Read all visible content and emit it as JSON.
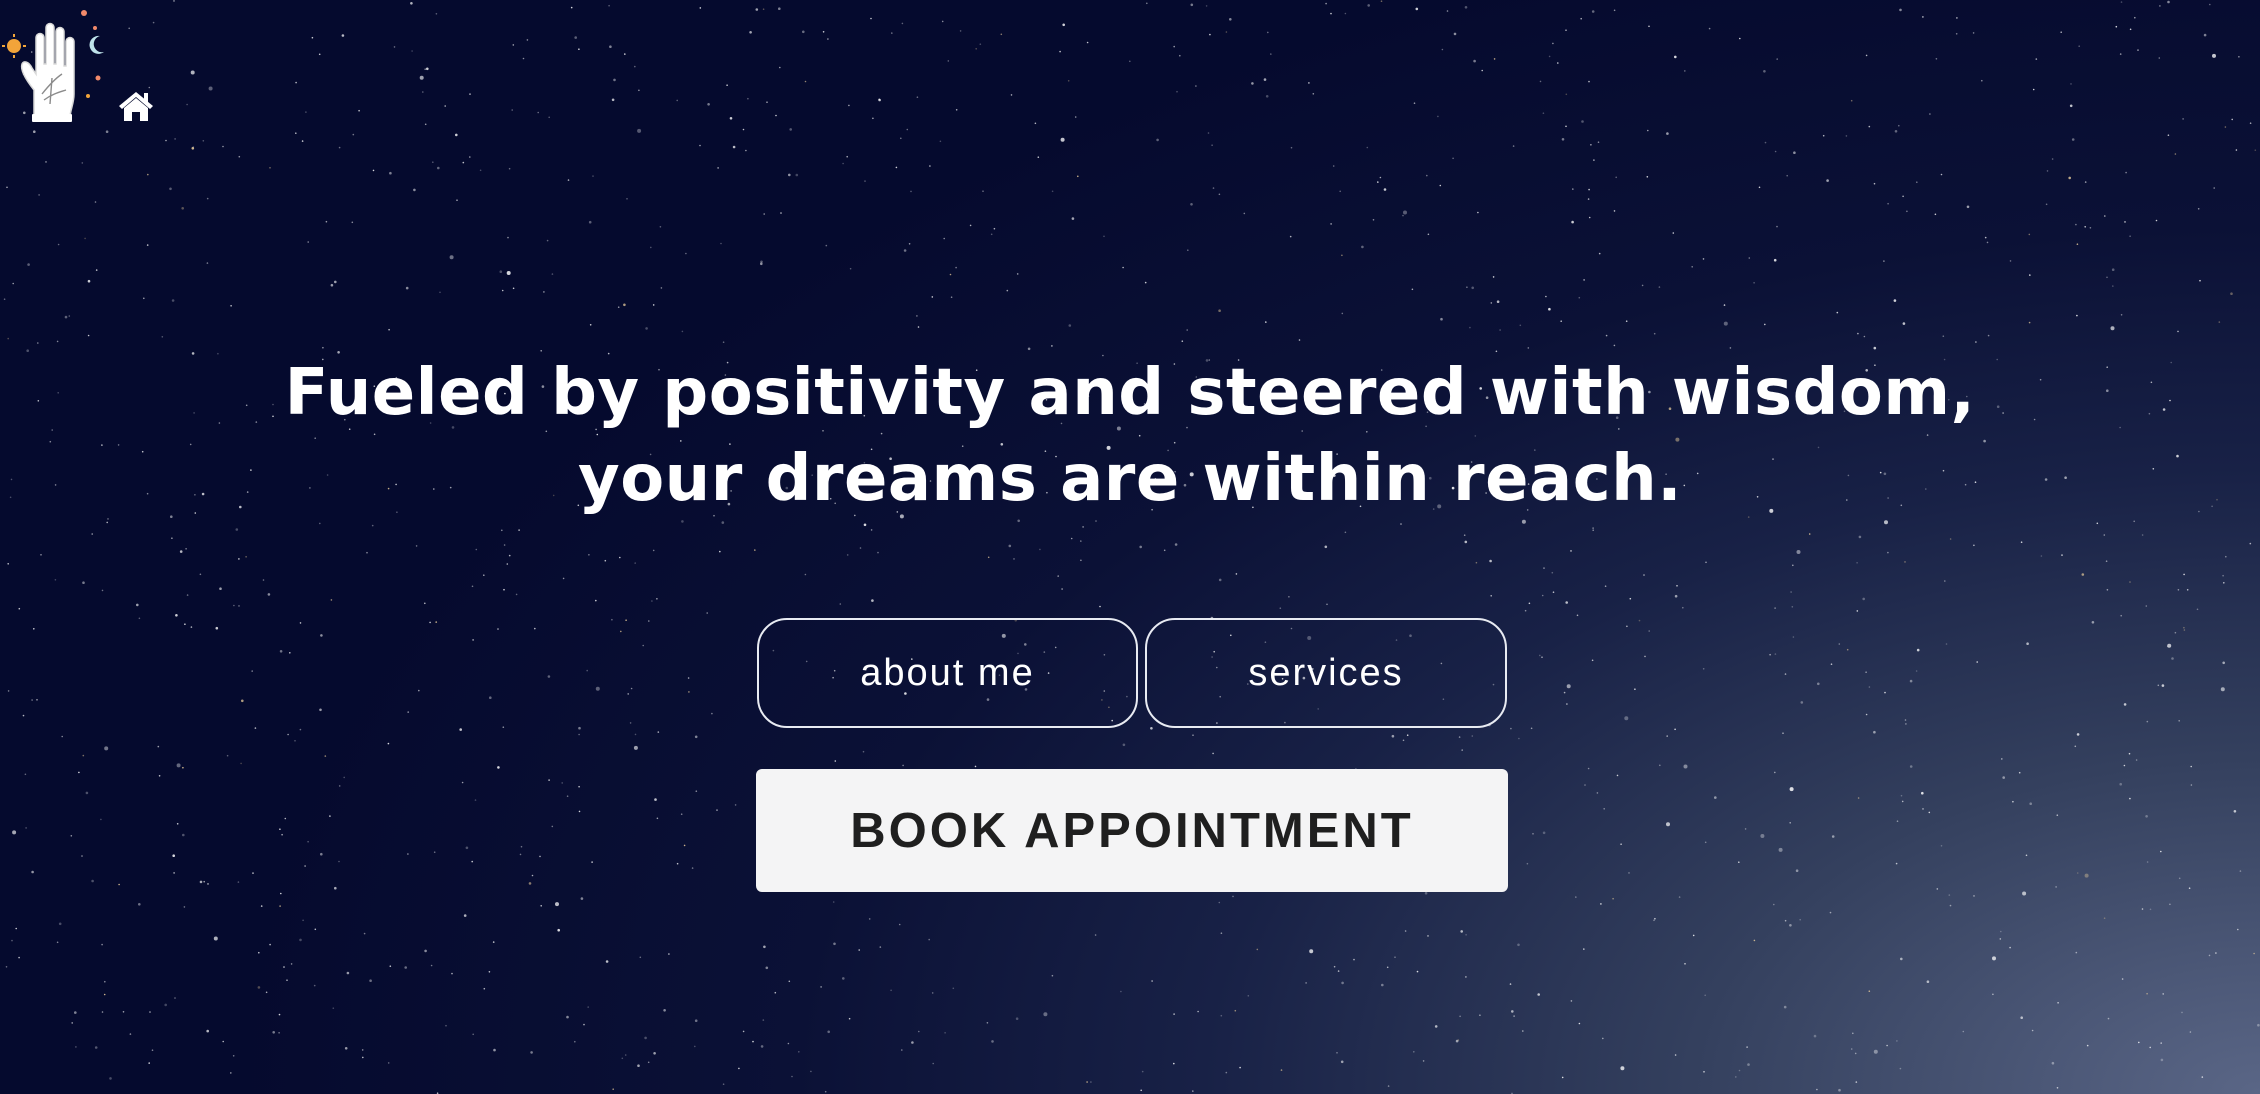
{
  "header": {
    "logo_icon": "palm-hand-with-sun-and-moon-icon",
    "home_icon": "home-icon"
  },
  "hero": {
    "title_line1": "Fueled by positivity and steered with wisdom,",
    "title_line2": "your dreams are within reach."
  },
  "nav": {
    "about_label": "about me",
    "services_label": "services"
  },
  "cta": {
    "book_label": "BOOK APPOINTMENT"
  },
  "colors": {
    "sky_dark": "#050a2e",
    "sky_light": "#5a6686",
    "button_bg": "#f4f4f5",
    "button_text": "#1f1f1f",
    "text": "#ffffff"
  }
}
